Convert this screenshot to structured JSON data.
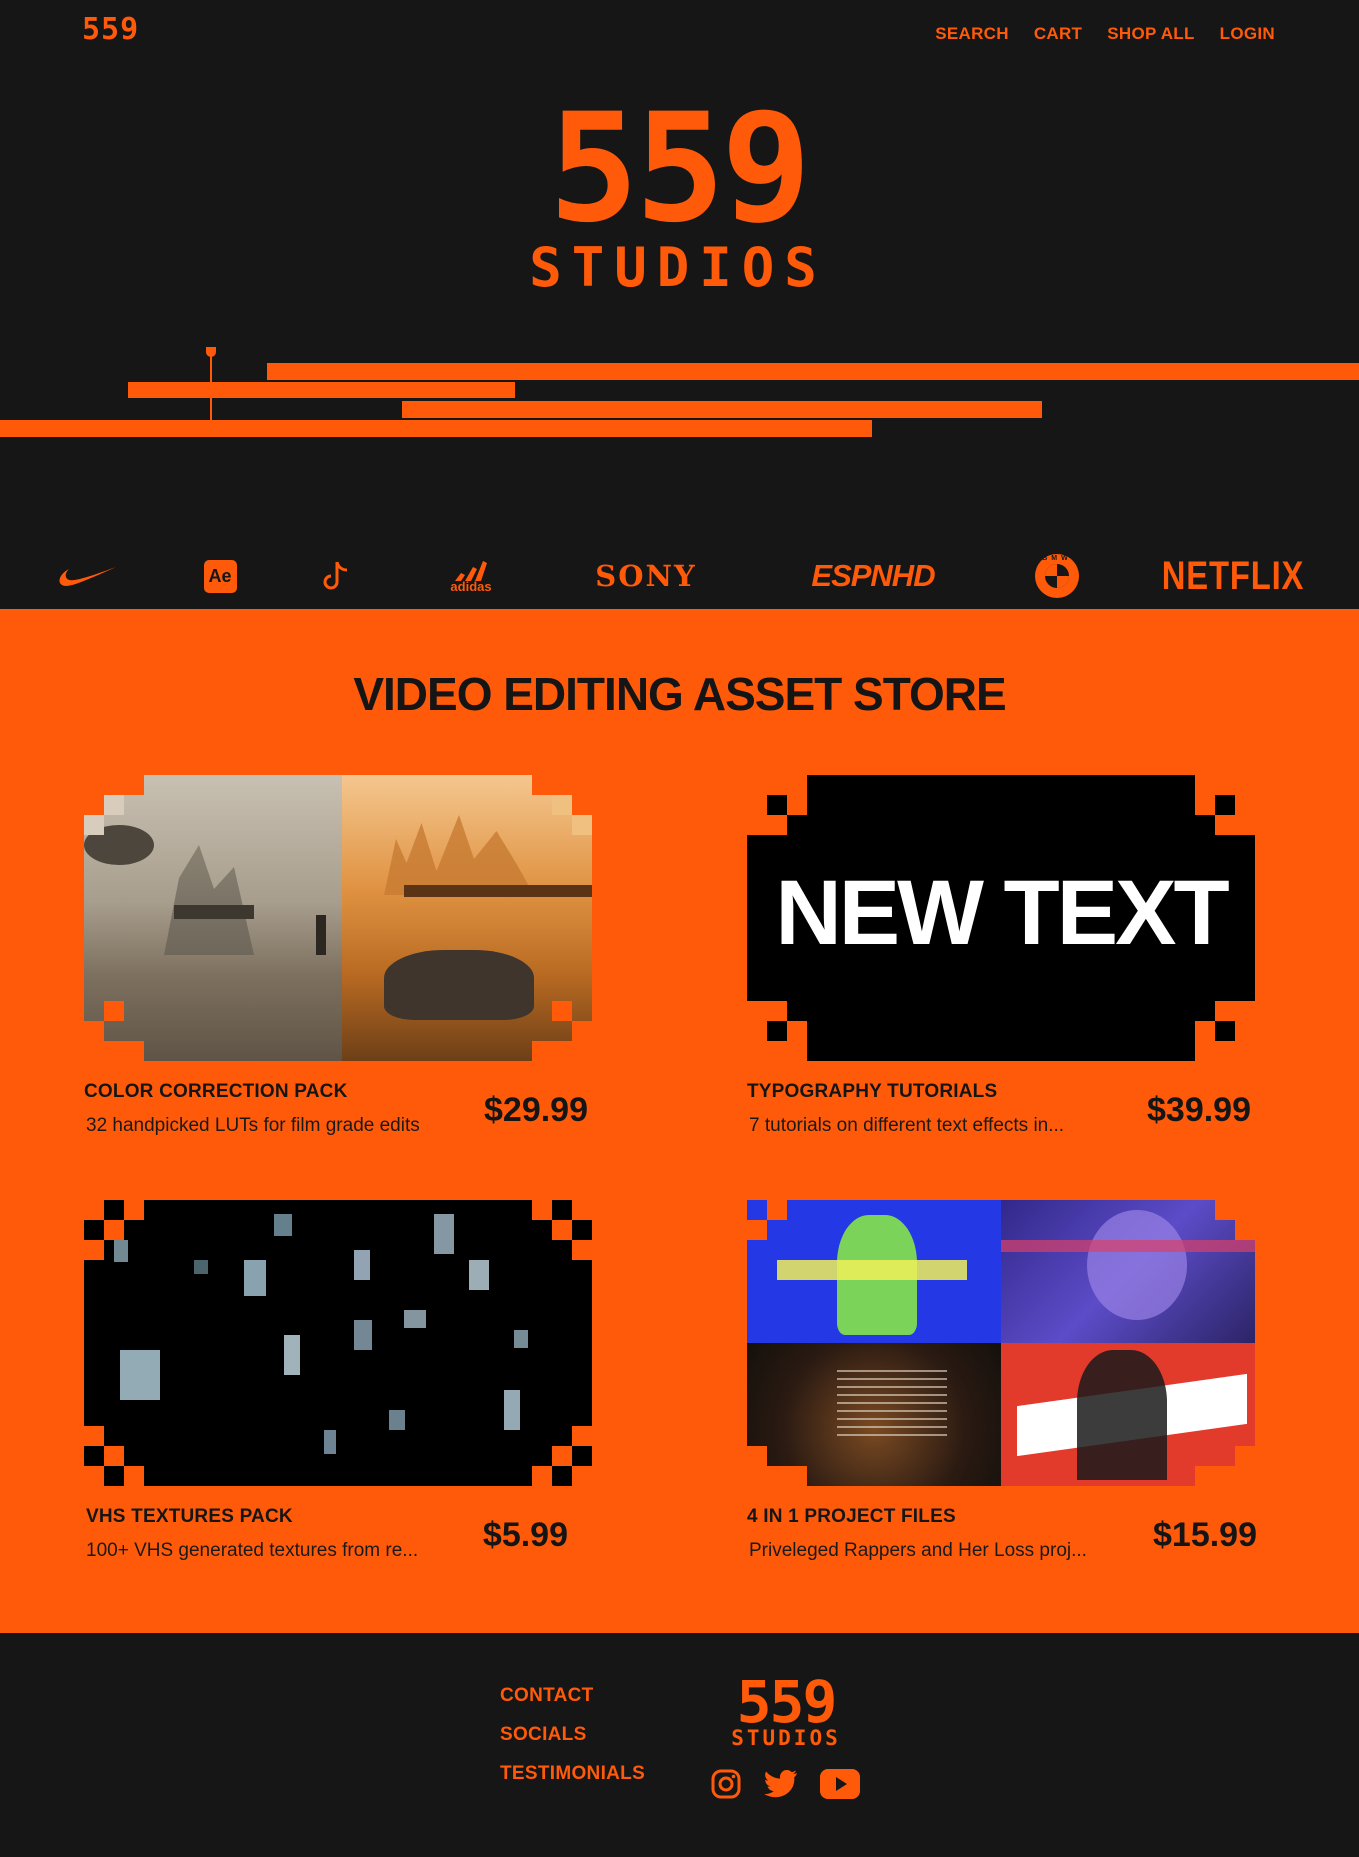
{
  "brand": {
    "mini_logo": "559",
    "hero_number": "559",
    "hero_word": "STUDIOS"
  },
  "nav": {
    "items": [
      "SEARCH",
      "CART",
      "SHOP ALL",
      "LOGIN"
    ]
  },
  "partners": {
    "items": [
      "nike-logo",
      "after-effects-logo",
      "tiktok-logo",
      "adidas-logo",
      "SONY",
      "ESPNHD",
      "bmw-logo",
      "NETFLIX"
    ],
    "adobe_label": "Ae",
    "adidas_label": "adidas",
    "sony_label": "SONY",
    "espn_label": "ESPNHD",
    "bmw_label": "BMW",
    "netflix_label": "NETFLIX"
  },
  "store": {
    "title": "VIDEO EDITING ASSET STORE",
    "products": [
      {
        "name": "COLOR CORRECTION PACK",
        "description": "32 handpicked LUTs for film grade edits",
        "price": "$29.99"
      },
      {
        "name": "TYPOGRAPHY TUTORIALS",
        "description": "7 tutorials on different text effects in...",
        "price": "$39.99",
        "thumb_text": "NEW TEXT"
      },
      {
        "name": "VHS TEXTURES PACK",
        "description": "100+ VHS generated textures from re...",
        "price": "$5.99"
      },
      {
        "name": "4 IN 1 PROJECT FILES",
        "description": "Priveleged Rappers and Her Loss proj...",
        "price": "$15.99"
      }
    ]
  },
  "footer": {
    "links": [
      "CONTACT",
      "SOCIALS",
      "TESTIMONIALS"
    ],
    "logo_number": "559",
    "logo_word": "STUDIOS",
    "socials": [
      "instagram-icon",
      "twitter-icon",
      "youtube-icon"
    ]
  },
  "colors": {
    "accent": "#ff5a0a",
    "dark": "#161616",
    "text_dark": "#151515"
  }
}
